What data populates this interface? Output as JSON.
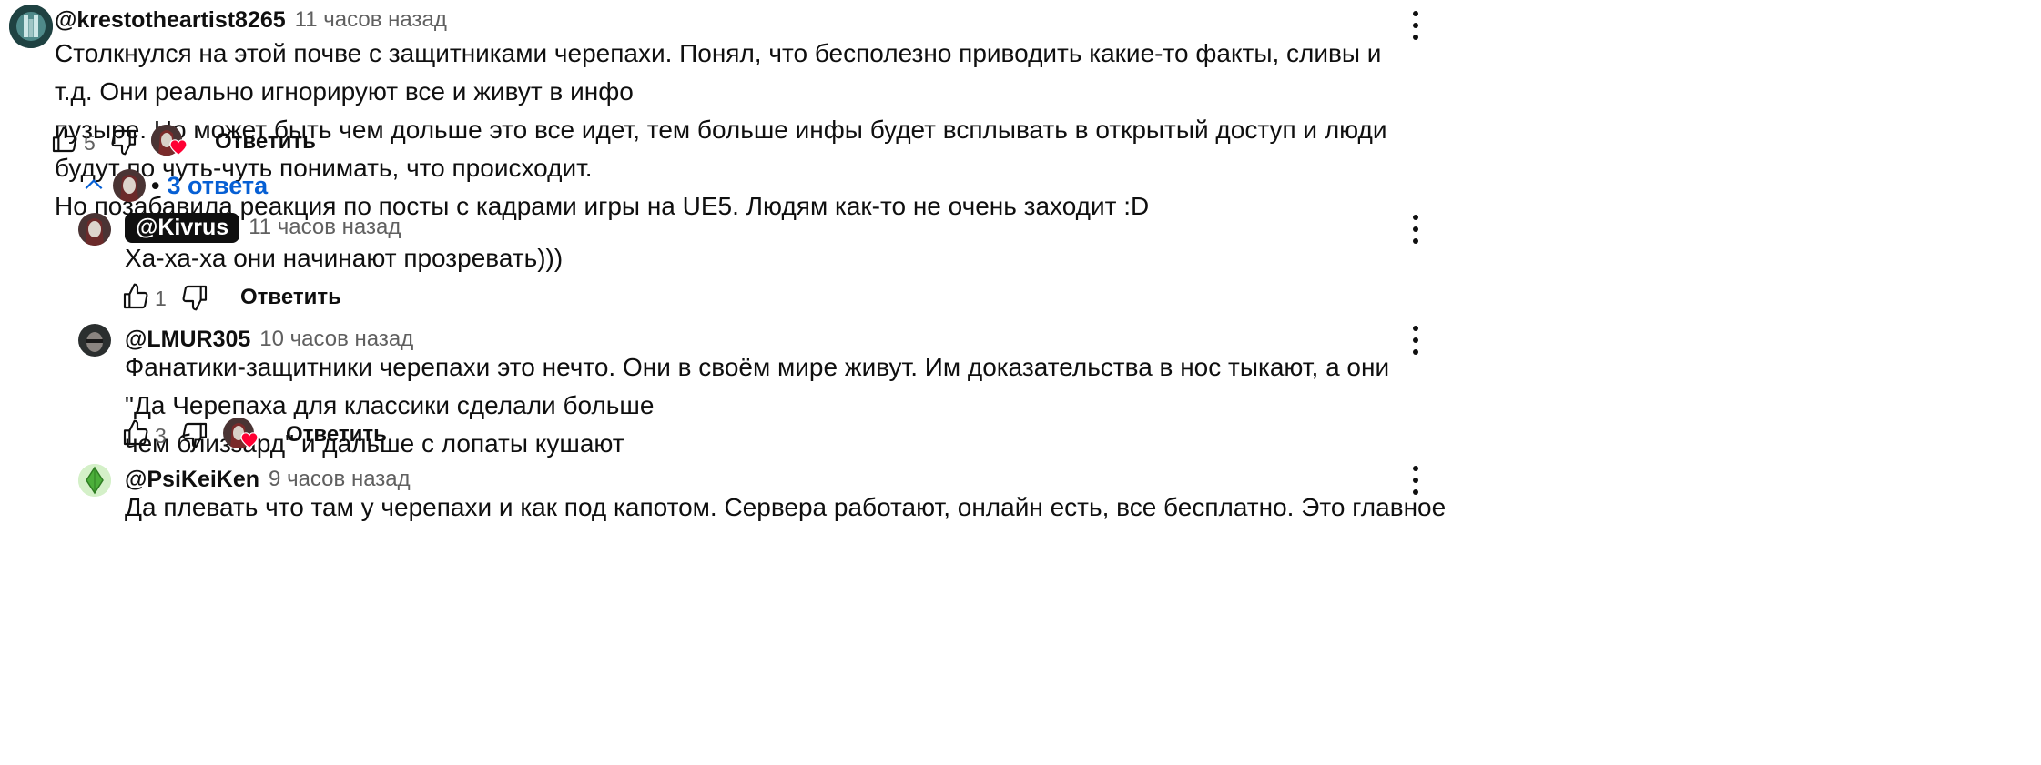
{
  "comment": {
    "author": "@krestotheartist8265",
    "time": "11 часов назад",
    "text_lines": [
      "Столкнулся на этой почве с защитниками черепахи. Понял, что бесполезно приводить какие-то факты, сливы и т.д. Они реально игнорируют все и живут в инфо",
      "пузыре. Но может быть чем дольше это все идет, тем больше инфы будет всплывать в открытый доступ и люди будут по чуть-чуть понимать, что происходит.",
      "Но позабавила реакция по посты с кадрами игры на UE5. Людям как-то не очень заходит :D"
    ],
    "likes": "5",
    "reply_label": "Ответить"
  },
  "replies_toggle": {
    "bullet": "•",
    "label": "3 ответа"
  },
  "replies": [
    {
      "author": "@Kivrus",
      "time": "11 часов назад",
      "text_lines": [
        "Ха-ха-ха они начинают прозревать)))"
      ],
      "likes": "1",
      "reply_label": "Ответить"
    },
    {
      "author": "@LMUR305",
      "time": "10 часов назад",
      "text_lines": [
        "Фанатики-защитники черепахи это нечто. Они в своём мире живут. Им доказательства в нос тыкают, а они \"Да Черепаха для классики сделали больше",
        "чем близзард\" и дальше с лопаты кушают"
      ],
      "likes": "3",
      "reply_label": "Ответить"
    },
    {
      "author": "@PsiKeiKen",
      "time": "9 часов назад",
      "text_lines": [
        "Да плевать что там у черепахи и как под капотом. Сервера работают, онлайн есть, все бесплатно. Это главное"
      ]
    }
  ],
  "colors": {
    "link_blue": "#065fd4",
    "secondary_text": "#606060",
    "heart_red": "#ff0033",
    "owner_chip_bg": "#0f0f0f"
  },
  "icons": [
    "like-icon",
    "dislike-icon",
    "more-vert-icon",
    "heart-icon",
    "chevron-up-icon"
  ]
}
